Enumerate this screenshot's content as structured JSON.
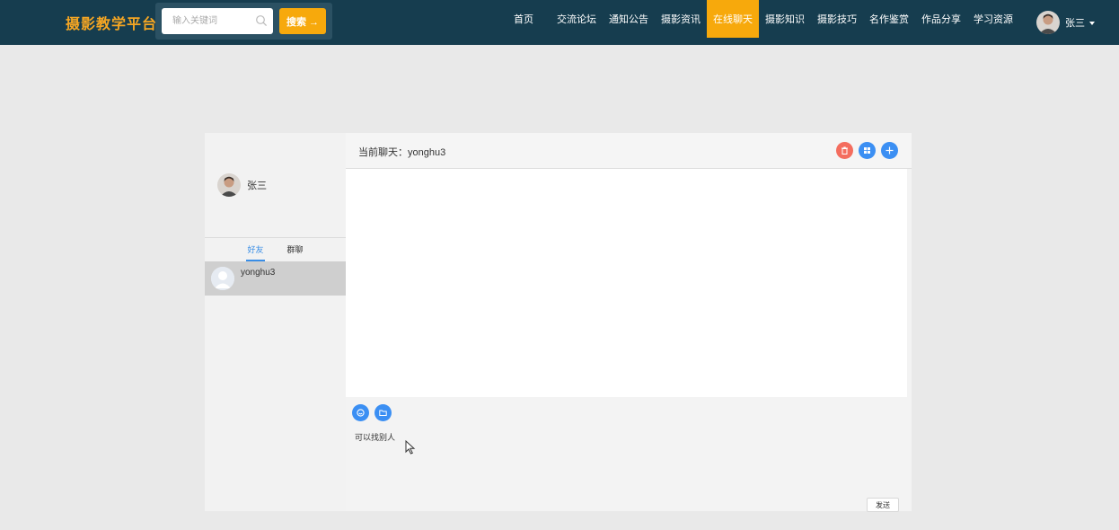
{
  "navbar": {
    "brand": "摄影教学平台",
    "search": {
      "placeholder": "输入关键词",
      "button_label": "搜索 →"
    },
    "items": [
      {
        "label": "首页",
        "active": false
      },
      {
        "label": "交流论坛",
        "active": false
      },
      {
        "label": "通知公告",
        "active": false
      },
      {
        "label": "摄影资讯",
        "active": false
      },
      {
        "label": "在线聊天",
        "active": true
      },
      {
        "label": "摄影知识",
        "active": false
      },
      {
        "label": "摄影技巧",
        "active": false
      },
      {
        "label": "名作鉴赏",
        "active": false
      },
      {
        "label": "作品分享",
        "active": false
      },
      {
        "label": "学习资源",
        "active": false
      }
    ],
    "user": {
      "name": "张三"
    }
  },
  "chat": {
    "me": {
      "name": "张三"
    },
    "tabs": [
      {
        "label": "好友",
        "active": true
      },
      {
        "label": "群聊",
        "active": false
      }
    ],
    "contacts": [
      {
        "name": "yonghu3",
        "selected": true
      }
    ],
    "header": {
      "title": "当前聊天：yonghu3"
    },
    "input_value": "可以找别人",
    "send_label": "发送"
  },
  "colors": {
    "navbar_bg": "#163d4f",
    "brand": "#f5a623",
    "accent_orange": "#f7a90c",
    "accent_blue": "#3b8ff3",
    "danger_red": "#f46d5e"
  }
}
